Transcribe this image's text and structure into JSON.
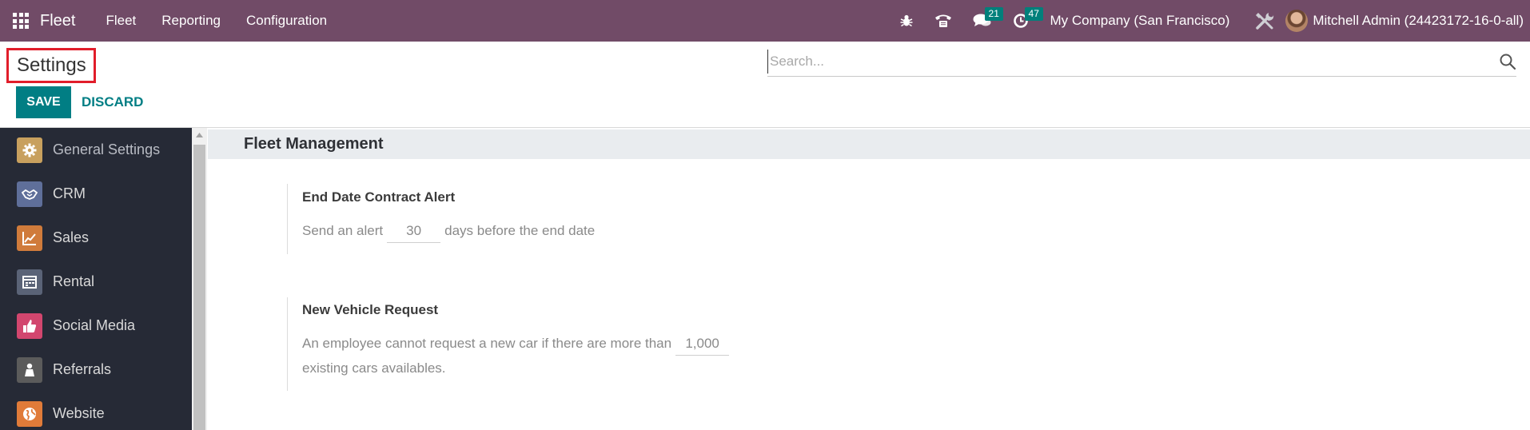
{
  "navbar": {
    "app_name": "Fleet",
    "menu": [
      "Fleet",
      "Reporting",
      "Configuration"
    ],
    "messages_count": "21",
    "activities_count": "47",
    "company": "My Company (San Francisco)",
    "user": "Mitchell Admin (24423172-16-0-all)",
    "icons": [
      "apps-grid-icon",
      "bug-icon",
      "phone-icon",
      "chat-icon",
      "clock-icon",
      "tools-icon"
    ]
  },
  "control_panel": {
    "breadcrumb": "Settings",
    "search_placeholder": "Search...",
    "save_label": "SAVE",
    "discard_label": "DISCARD"
  },
  "sidebar": {
    "items": [
      {
        "label": "General Settings",
        "color": "#c8a05e"
      },
      {
        "label": "CRM",
        "color": "#5f6f9a"
      },
      {
        "label": "Sales",
        "color": "#d07b3b"
      },
      {
        "label": "Rental",
        "color": "#5a6377"
      },
      {
        "label": "Social Media",
        "color": "#d2466e"
      },
      {
        "label": "Referrals",
        "color": "#5b5b5b"
      },
      {
        "label": "Website",
        "color": "#e07b39"
      }
    ]
  },
  "content": {
    "section_title": "Fleet Management",
    "settings": [
      {
        "title": "End Date Contract Alert",
        "text_before": "Send an alert",
        "value": "30",
        "text_after": "days before the end date"
      },
      {
        "title": "New Vehicle Request",
        "text_before": "An employee cannot request a new car if there are more than",
        "value": "1,000",
        "text_after": "existing cars availables."
      }
    ]
  },
  "colors": {
    "navbar": "#714b67",
    "primary": "#017e84",
    "sidebar": "#262a36",
    "badge": "#01807b"
  }
}
